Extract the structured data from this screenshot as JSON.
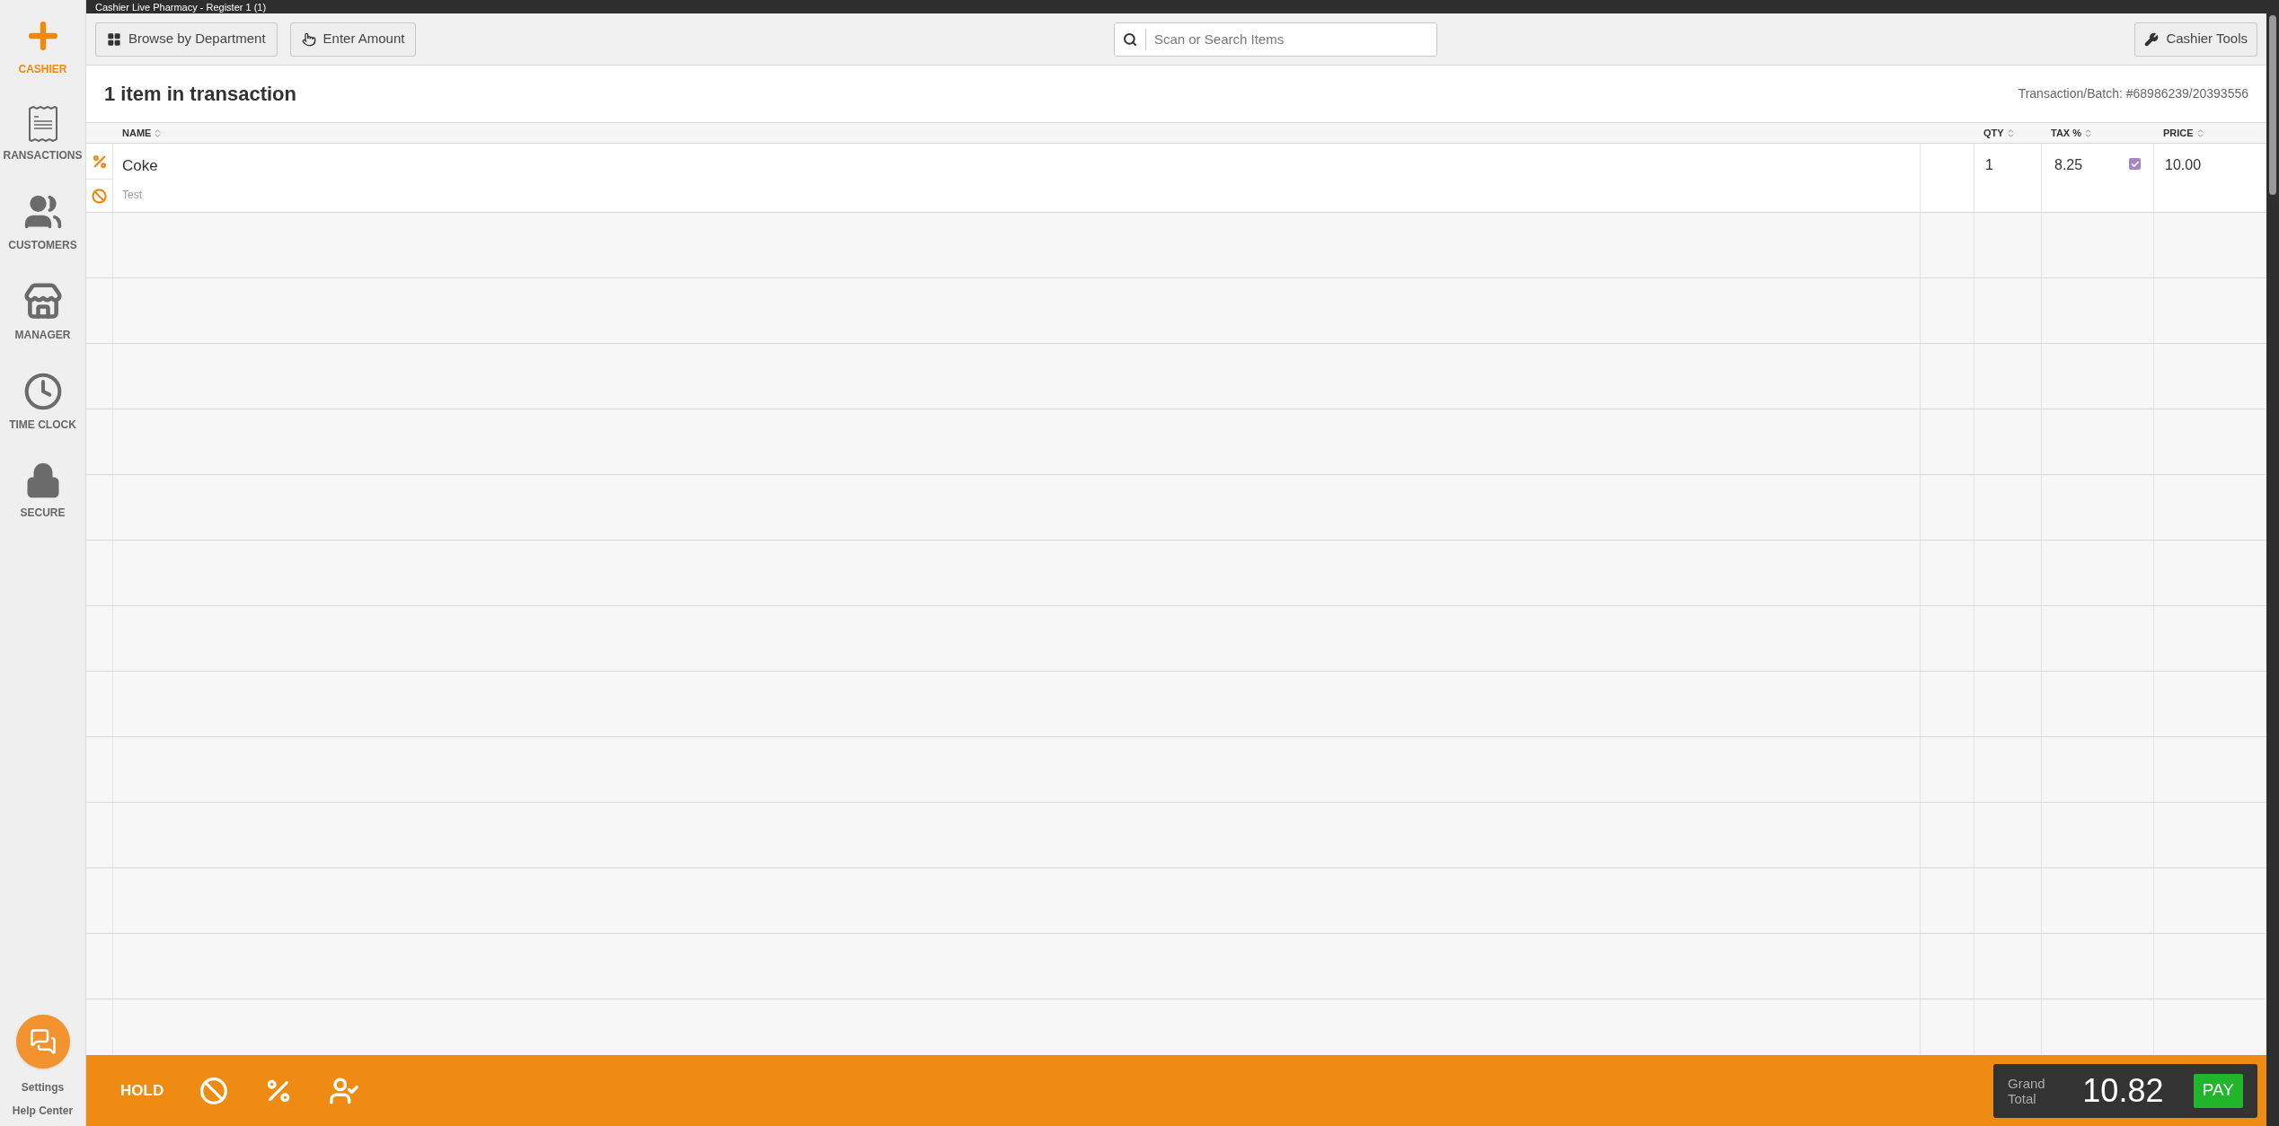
{
  "window": {
    "title": "Cashier Live Pharmacy - Register 1 (1)"
  },
  "sidebar": {
    "items": [
      {
        "kind": "cashier",
        "label": "CASHIER",
        "selected": true
      },
      {
        "kind": "transactions",
        "label": "RANSACTIONS",
        "selected": false
      },
      {
        "kind": "customers",
        "label": "CUSTOMERS",
        "selected": false
      },
      {
        "kind": "manager",
        "label": "MANAGER",
        "selected": false
      },
      {
        "kind": "timeclock",
        "label": "TIME CLOCK",
        "selected": false
      },
      {
        "kind": "secure",
        "label": "SECURE",
        "selected": false
      }
    ],
    "links": [
      "Settings",
      "Help Center"
    ]
  },
  "toolbar": {
    "buttons": [
      {
        "kind": "browse",
        "label": "Browse by Department"
      },
      {
        "kind": "amount",
        "label": "Enter Amount"
      }
    ],
    "search": {
      "placeholder": "Scan or Search Items"
    },
    "tools_button": "Cashier Tools"
  },
  "transaction": {
    "heading": "1 item in transaction",
    "batch": "Transaction/Batch: #68986239/20393556"
  },
  "table": {
    "columns": [
      "NAME",
      "QTY",
      "TAX %",
      "PRICE"
    ],
    "rows": [
      {
        "name": "Coke",
        "note": "Test",
        "qty": "1",
        "tax": "8.25",
        "taxed": true,
        "price": "10.00"
      }
    ]
  },
  "footer": {
    "hold": "HOLD",
    "grand_total_label": "Grand Total",
    "grand_total": "10.82",
    "pay": "PAY"
  }
}
